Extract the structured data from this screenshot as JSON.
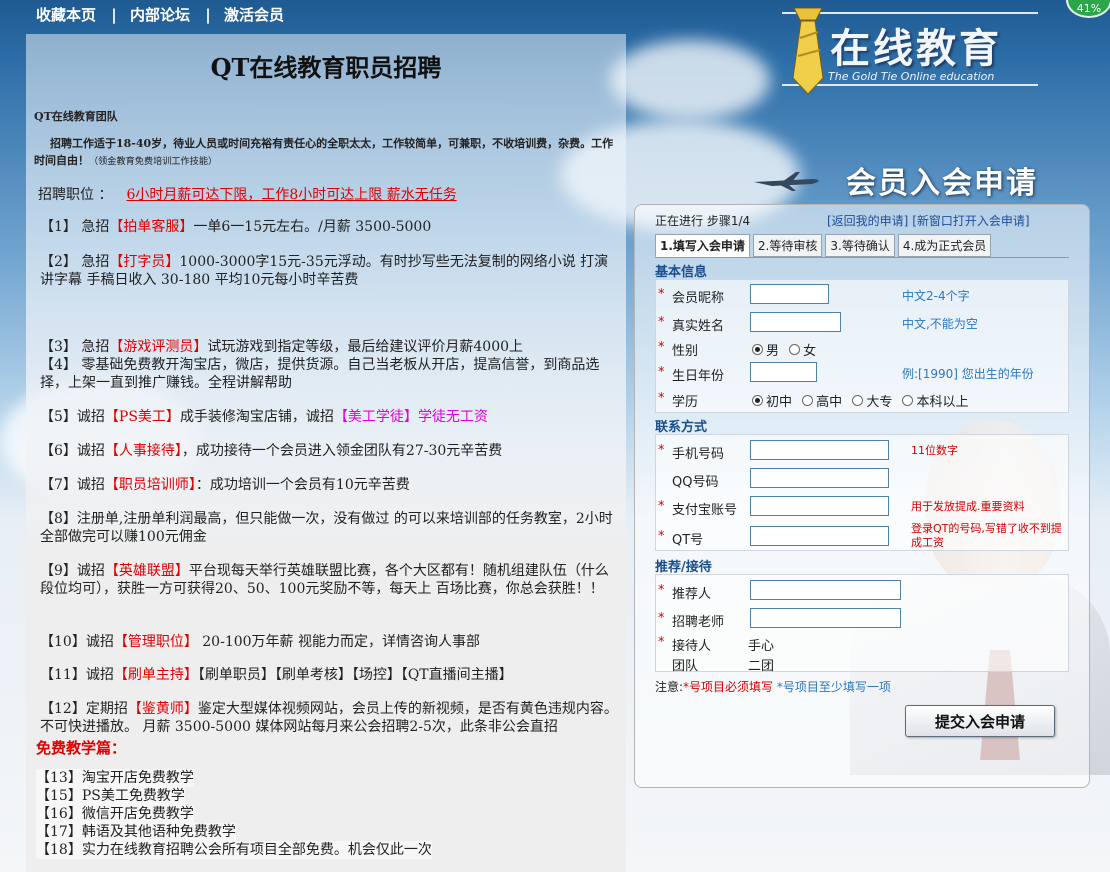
{
  "topnav": {
    "items": [
      "收藏本页",
      "内部论坛",
      "激活会员"
    ],
    "sep": "|"
  },
  "badge": "41%",
  "logo": {
    "name": "在线教育",
    "sub": "The Gold Tie Online education"
  },
  "join_title": "会员入会申请",
  "left": {
    "title": "QT在线教育职员招聘",
    "team": "QT在线教育团队",
    "intro": "招聘工作适于18-40岁，待业人员或时间充裕有责任心的全职太太，工作较简单，可兼职，不收培训费，杂费。工作时间自由！",
    "intro_tail": "（领金教育免费培训工作技能）",
    "pos_label": "招聘职位 ：",
    "pos_link": "6小时月薪可达下限，工作8小时可达上限 薪水无任务",
    "jobs": [
      {
        "num": "【1】",
        "pre": "急招",
        "tag": "【拍单客服】",
        "text": "一单6一15元左右。/月薪 3500-5000"
      },
      {
        "num": "【2】",
        "pre": "急招",
        "tag": "【打字员】",
        "text": "1000-3000字15元-35元浮动。有时抄写些无法复制的网络小说 打演讲字幕 手稿日收入 30-180 平均10元每小时辛苦费"
      },
      {
        "num": "【3】",
        "pre": "急招",
        "tag": "【游戏评测员】",
        "text": "试玩游戏到指定等级，最后给建议评价月薪4000上"
      },
      {
        "num": "【4】",
        "pre": "",
        "tag": "",
        "text": "零基础免费教开淘宝店，微店，提供货源。自己当老板从开店，提高信誉，到商品选择，上架一直到推广赚钱。全程讲解帮助"
      },
      {
        "num": "【5】",
        "pre": "诚招",
        "tag": "【PS美工】",
        "text": "成手装修淘宝店铺，诚招",
        "tag2": "【美工学徒】",
        "text2": "学徒无工资"
      },
      {
        "num": "【6】",
        "pre": "诚招",
        "tag": "【人事接待】",
        "text": "，成功接待一个会员进入领金团队有27-30元辛苦费"
      },
      {
        "num": "【7】",
        "pre": "诚招",
        "tag": "【职员培训师】",
        "text": "：成功培训一个会员有10元辛苦费"
      },
      {
        "num": "【8】",
        "pre": "",
        "tag": "",
        "text": "注册单,注册单利润最高，但只能做一次，没有做过 的可以来培训部的任务教室，2小时全部做完可以赚100元佣金"
      },
      {
        "num": "【9】",
        "pre": "诚招",
        "tag": "【英雄联盟】",
        "text": "平台现每天举行英雄联盟比赛，各个大区都有！随机组建队伍（什么段位均可），获胜一方可获得20、50、100元奖励不等，每天上 百场比赛，你总会获胜！！"
      },
      {
        "num": "【10】",
        "pre": "诚招",
        "tag": "【管理职位】",
        "text": " 20-100万年薪  视能力而定，详情咨询人事部"
      },
      {
        "num": "【11】",
        "pre": "诚招",
        "tag": "【刷单主持】",
        "text": "【刷单职员】【刷单考核】【场控】【QT直播间主播】"
      },
      {
        "num": "【12】",
        "pre": "定期招",
        "tag": "【鉴黄师】",
        "text": "鉴定大型媒体视频网站，会员上传的新视频，是否有黄色违规内容。不可快进播放。 月薪 3500-5000  媒体网站每月来公会招聘2-5次，此条非公会直招"
      }
    ],
    "free_title": "免费教学篇：",
    "free": [
      "【13】淘宝开店免费教学",
      "【15】PS美工免费教学",
      "【16】微信开店免费教学",
      "【17】韩语及其他语种免费教学",
      "【18】实力在线教育招聘公会所有项目全部免费。机会仅此一次"
    ]
  },
  "form": {
    "step": "正在进行 步骤1/4",
    "link_back": "[返回我的申请]",
    "link_new": "[新窗口打开入会申请]",
    "tabs": [
      "1.填写入会申请",
      "2.等待审核",
      "3.等待确认",
      "4.成为正式会员"
    ],
    "sec_basic": "基本信息",
    "nickname": {
      "label": "会员昵称",
      "hint": "中文2-4个字",
      "value": ""
    },
    "realname": {
      "label": "真实姓名",
      "hint": "中文,不能为空",
      "value": ""
    },
    "gender": {
      "label": "性别",
      "options": [
        "男",
        "女"
      ]
    },
    "birth": {
      "label": "生日年份",
      "hint": "例:[1990] 您出生的年份",
      "value": ""
    },
    "edu": {
      "label": "学历",
      "options": [
        "初中",
        "高中",
        "大专",
        "本科以上"
      ]
    },
    "sec_contact": "联系方式",
    "phone": {
      "label": "手机号码",
      "hint": "11位数字",
      "value": ""
    },
    "qq": {
      "label": "QQ号码",
      "value": ""
    },
    "alipay": {
      "label": "支付宝账号",
      "hint": "用于发放提成.重要资料",
      "value": ""
    },
    "qt": {
      "label": "QT号",
      "hint": "登录QT的号码,写错了收不到提成工资",
      "value": ""
    },
    "sec_ref": "推荐/接待",
    "referrer": {
      "label": "推荐人",
      "value": ""
    },
    "teacher": {
      "label": "招聘老师",
      "value": ""
    },
    "receiver": {
      "label": "接待人",
      "value": "手心"
    },
    "team": {
      "label": "团队",
      "value": "二团"
    },
    "note_prefix": "注意:",
    "note_red": "*号项目必须填写",
    "note_blue": "*号项目至少填写一项",
    "submit": "提交入会申请"
  },
  "colors": {
    "accent_red": "#e00000",
    "magenta": "#e000e0",
    "link_blue": "#1d4f9a"
  }
}
